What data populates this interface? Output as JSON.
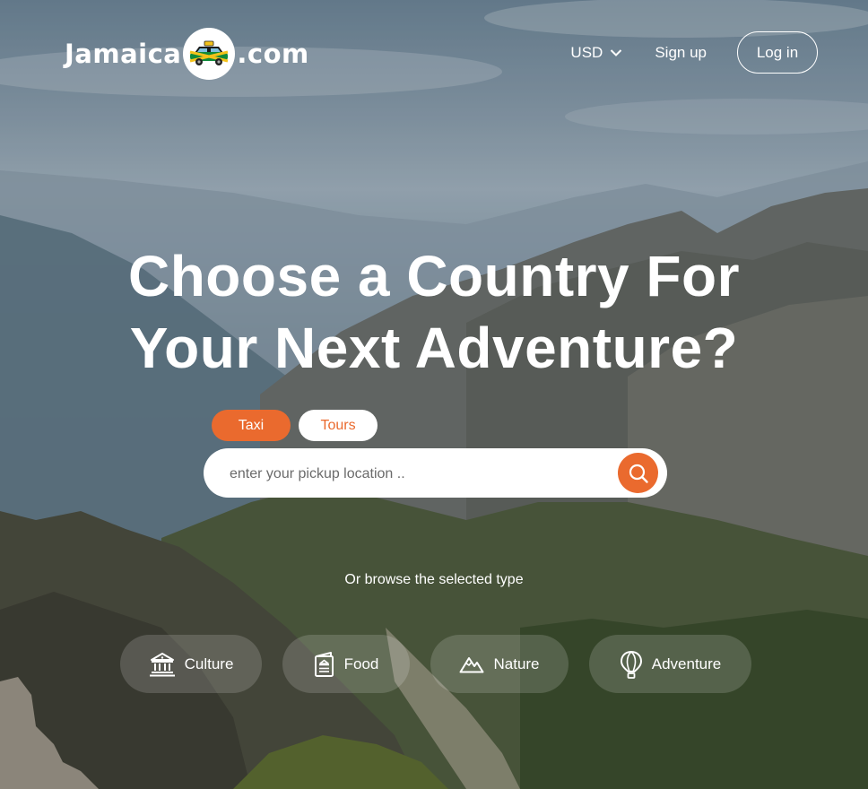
{
  "colors": {
    "accent": "#ea6a2e",
    "text": "#ffffff"
  },
  "header": {
    "logo": {
      "prefix": "Jamaica",
      "suffix": ".com",
      "badge_icon": "taxi-car-icon"
    },
    "currency": {
      "label": "USD",
      "icon": "chevron-down-icon"
    },
    "signup_label": "Sign up",
    "login_label": "Log in"
  },
  "hero": {
    "headline_line1": "Choose a Country For",
    "headline_line2": "Your Next Adventure?"
  },
  "tabs": [
    {
      "label": "Taxi",
      "active": true
    },
    {
      "label": "Tours",
      "active": false
    }
  ],
  "search": {
    "placeholder": "enter your pickup location ..",
    "value": "",
    "button_icon": "search-icon"
  },
  "browse_text": "Or browse the selected type",
  "categories": [
    {
      "label": "Culture",
      "icon": "museum-icon"
    },
    {
      "label": "Food",
      "icon": "menu-icon"
    },
    {
      "label": "Nature",
      "icon": "mountain-icon"
    },
    {
      "label": "Adventure",
      "icon": "hot-air-balloon-icon"
    }
  ]
}
